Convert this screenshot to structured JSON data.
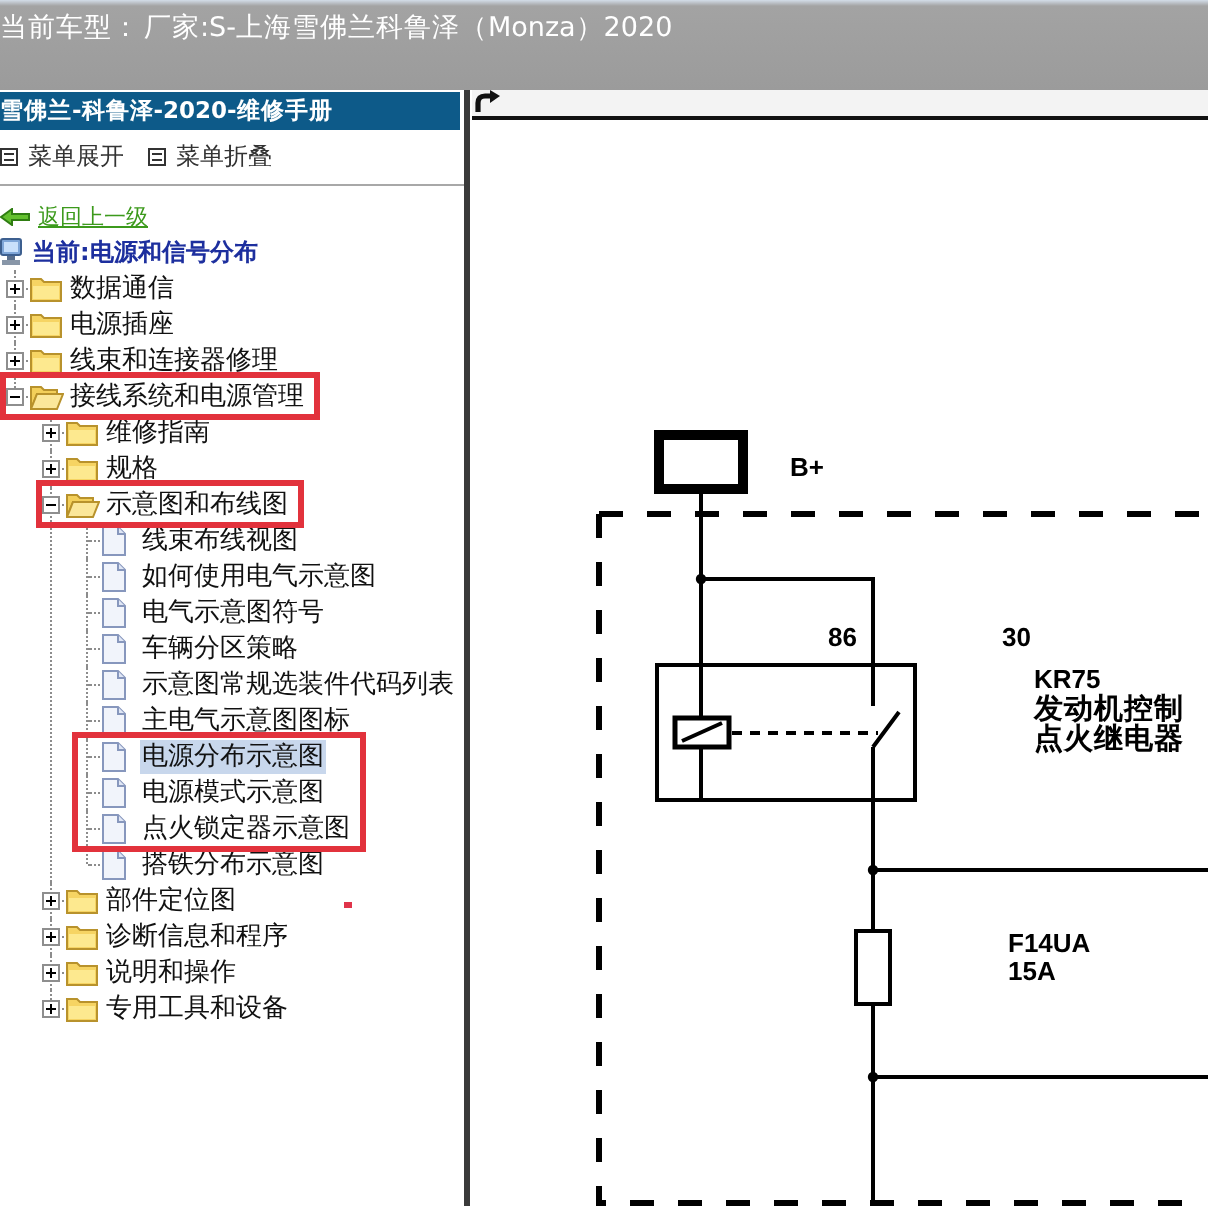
{
  "header": {
    "label": "当前车型：",
    "value": "厂家:S-上海雪佛兰科鲁泽（Monza）2020"
  },
  "sidebar": {
    "title": "雪佛兰-科鲁泽-2020-维修手册",
    "menu_actions": [
      {
        "label": "菜单展开"
      },
      {
        "label": "菜单折叠"
      }
    ],
    "back_link": "返回上一级",
    "current_section": "当前:电源和信号分布",
    "annotation_dot": true,
    "tree": [
      {
        "label": "数据通信",
        "kind": "folder",
        "expanded": false,
        "selected": false,
        "highlighted": false
      },
      {
        "label": "电源插座",
        "kind": "folder",
        "expanded": false,
        "selected": false,
        "highlighted": false
      },
      {
        "label": "线束和连接器修理",
        "kind": "folder",
        "expanded": false,
        "selected": false,
        "highlighted": false
      },
      {
        "label": "接线系统和电源管理",
        "kind": "folder",
        "expanded": true,
        "selected": false,
        "highlighted": true,
        "children": [
          {
            "label": "维修指南",
            "kind": "folder",
            "expanded": false,
            "selected": false,
            "highlighted": false
          },
          {
            "label": "规格",
            "kind": "folder",
            "expanded": false,
            "selected": false,
            "highlighted": false
          },
          {
            "label": "示意图和布线图",
            "kind": "folder",
            "expanded": true,
            "selected": false,
            "highlighted": true,
            "children": [
              {
                "label": "线束布线视图",
                "kind": "page",
                "selected": false,
                "highlighted": false
              },
              {
                "label": "如何使用电气示意图",
                "kind": "page",
                "selected": false,
                "highlighted": false
              },
              {
                "label": "电气示意图符号",
                "kind": "page",
                "selected": false,
                "highlighted": false
              },
              {
                "label": "车辆分区策略",
                "kind": "page",
                "selected": false,
                "highlighted": false
              },
              {
                "label": "示意图常规选装件代码列表",
                "kind": "page",
                "selected": false,
                "highlighted": false
              },
              {
                "label": "主电气示意图图标",
                "kind": "page",
                "selected": false,
                "highlighted": false
              },
              {
                "label": "电源分布示意图",
                "kind": "page",
                "selected": true,
                "highlighted": true
              },
              {
                "label": "电源模式示意图",
                "kind": "page",
                "selected": false,
                "highlighted": true
              },
              {
                "label": "点火锁定器示意图",
                "kind": "page",
                "selected": false,
                "highlighted": true
              },
              {
                "label": "搭铁分布示意图",
                "kind": "page",
                "selected": false,
                "highlighted": false
              }
            ]
          },
          {
            "label": "部件定位图",
            "kind": "folder",
            "expanded": false,
            "selected": false,
            "highlighted": false
          },
          {
            "label": "诊断信息和程序",
            "kind": "folder",
            "expanded": false,
            "selected": false,
            "highlighted": false
          },
          {
            "label": "说明和操作",
            "kind": "folder",
            "expanded": false,
            "selected": false,
            "highlighted": false
          },
          {
            "label": "专用工具和设备",
            "kind": "folder",
            "expanded": false,
            "selected": false,
            "highlighted": false
          }
        ]
      }
    ]
  },
  "diagram": {
    "connector": {
      "label": "B+"
    },
    "relay": {
      "pins": [
        "86",
        "30"
      ],
      "id": "KR75",
      "name_lines": [
        "发动机控制",
        "点火继电器"
      ],
      "contact_closed": false
    },
    "fuse": {
      "id": "F14UA",
      "rating": "15A"
    }
  }
}
